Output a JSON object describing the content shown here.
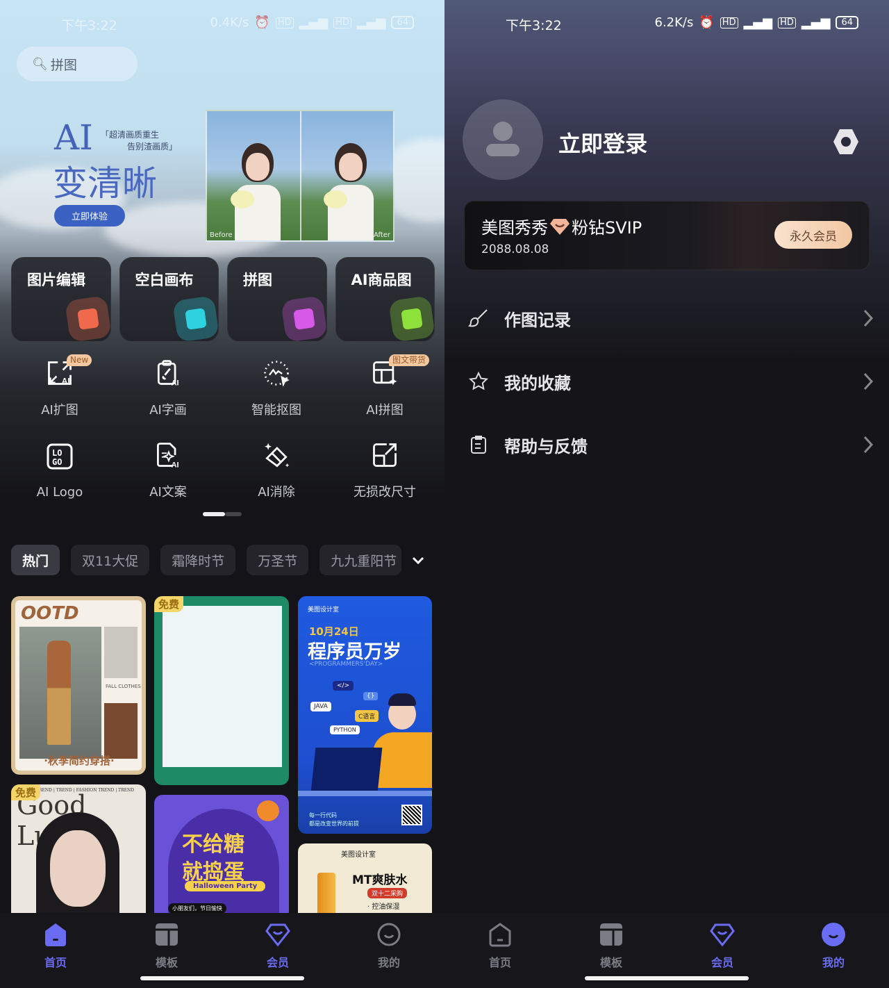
{
  "left": {
    "status_bar": {
      "time": "下午3:22",
      "speed": "0.4K/s",
      "hd1": "HD",
      "hd2": "HD",
      "battery": "64"
    },
    "search": {
      "placeholder": "拼图"
    },
    "banner": {
      "title_ai": "AI",
      "subtitle_line1": "「超清画质重生",
      "subtitle_line2": "告别渣画质」",
      "title_main": "变清晰",
      "cta": "立即体验",
      "before_label": "Before",
      "after_label": "After"
    },
    "feature_tiles": [
      {
        "label": "图片编辑",
        "icon": "image-edit-icon",
        "color": "#ef6a4c"
      },
      {
        "label": "空白画布",
        "icon": "blank-canvas-icon",
        "color": "#2fd3e0"
      },
      {
        "label": "拼图",
        "icon": "collage-icon",
        "color": "#d65ae6"
      },
      {
        "label": "AI商品图",
        "icon": "shopping-bag-icon",
        "color": "#8ee03a"
      }
    ],
    "ai_tools": [
      {
        "label": "AI扩图",
        "icon": "ai-expand-icon",
        "badge": "New"
      },
      {
        "label": "AI字画",
        "icon": "ai-calligraphy-icon"
      },
      {
        "label": "智能抠图",
        "icon": "smart-cutout-icon"
      },
      {
        "label": "AI拼图",
        "icon": "ai-collage-icon",
        "badge": "图文带货"
      },
      {
        "label": "AI Logo",
        "icon": "ai-logo-icon"
      },
      {
        "label": "AI文案",
        "icon": "ai-copywriting-icon"
      },
      {
        "label": "AI消除",
        "icon": "ai-eraser-icon"
      },
      {
        "label": "无损改尺寸",
        "icon": "resize-icon"
      }
    ],
    "pager": {
      "current": 1,
      "total": 2
    },
    "categories": [
      "热门",
      "双11大促",
      "霜降时节",
      "万圣节",
      "九九重阳节"
    ],
    "active_category": "热门",
    "templates": {
      "ootd": {
        "title": "OOTD",
        "caption": "·秋季简约穿搭·",
        "side_text": "FALL CLOTHES"
      },
      "blank_board": {
        "badge": "免费"
      },
      "programmer": {
        "brand": "美图设计室",
        "date": "10月24日",
        "title": "程序员万岁",
        "subtitle": "<PROGRAMMERS'DAY>",
        "tags": [
          "</>",
          "JAVA",
          "C语言",
          "PYTHON",
          "{}"
        ],
        "footer_line1": "每一行代码",
        "footer_line2": "都是改变世界的前提"
      },
      "good_luck": {
        "badge": "免费",
        "header": "TREND | TREND | FASHION TREND | TREND",
        "title": "Good Luck"
      },
      "halloween": {
        "title_line1": "不给糖",
        "title_line2": "就捣蛋",
        "ribbon": "Halloween Party",
        "footer": "小朋友们，节日愉快"
      },
      "toner": {
        "brand": "美图设计室",
        "title": "MT爽肤水",
        "tag": "双十二采购",
        "feature": "· 控油保湿"
      }
    },
    "nav": [
      {
        "label": "首页",
        "icon": "home-icon",
        "active": true
      },
      {
        "label": "模板",
        "icon": "template-icon",
        "active": false
      },
      {
        "label": "会员",
        "icon": "vip-diamond-icon",
        "active": true
      },
      {
        "label": "我的",
        "icon": "profile-icon",
        "active": false
      }
    ]
  },
  "right": {
    "status_bar": {
      "time": "下午3:22",
      "speed": "6.2K/s",
      "hd1": "HD",
      "hd2": "HD",
      "battery": "64"
    },
    "profile": {
      "login_label": "立即登录"
    },
    "vip_card": {
      "brand": "美图秀秀",
      "tier": "粉钻SVIP",
      "expiry": "2088.08.08",
      "button": "永久会员"
    },
    "menu": [
      {
        "label": "作图记录",
        "icon": "brush-icon"
      },
      {
        "label": "我的收藏",
        "icon": "star-icon"
      },
      {
        "label": "帮助与反馈",
        "icon": "clipboard-icon"
      }
    ],
    "nav": [
      {
        "label": "首页",
        "icon": "home-icon",
        "active": false
      },
      {
        "label": "模板",
        "icon": "template-icon",
        "active": false
      },
      {
        "label": "会员",
        "icon": "vip-diamond-icon",
        "active": true
      },
      {
        "label": "我的",
        "icon": "profile-icon",
        "active": true
      }
    ]
  },
  "colors": {
    "accent": "#6b6cf4",
    "banner_blue": "#3b62c2",
    "vip_gold": "#f2c8a4"
  }
}
